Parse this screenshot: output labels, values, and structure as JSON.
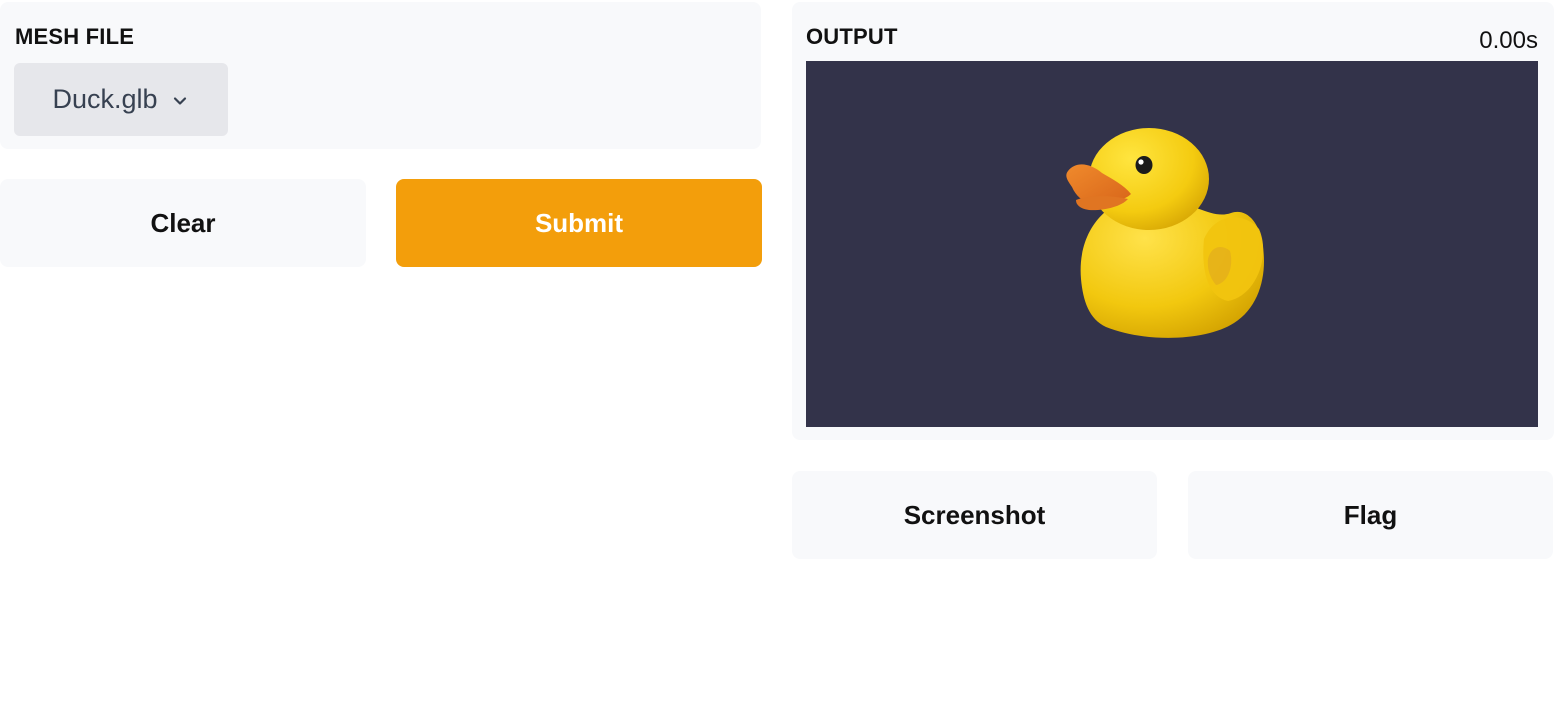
{
  "input": {
    "label": "MESH FILE",
    "dropdown": {
      "selected": "Duck.glb",
      "icon": "chevron-down-icon"
    }
  },
  "actions": {
    "clear_label": "Clear",
    "submit_label": "Submit"
  },
  "output": {
    "label": "OUTPUT",
    "time": "0.00s",
    "viewer": {
      "background": "#33334a",
      "model": "duck"
    }
  },
  "output_actions": {
    "screenshot_label": "Screenshot",
    "flag_label": "Flag"
  },
  "colors": {
    "primary": "#f39e0b",
    "panel": "#f8f9fb",
    "dropdown": "#e6e7eb"
  }
}
